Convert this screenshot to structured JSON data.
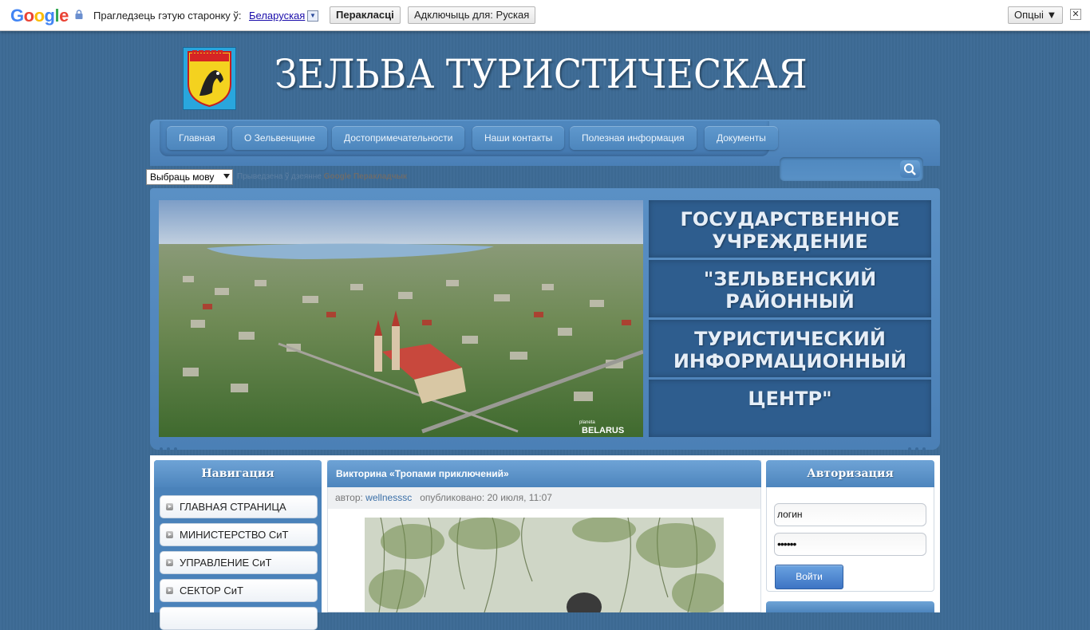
{
  "translate_bar": {
    "prompt": "Прагледзець гэтую старонку ў:",
    "language": "Беларуская",
    "translate_button": "Перакласці",
    "disable_button": "Адключыць для: Руская",
    "options_button": "Опцыі ▼",
    "close": "✕"
  },
  "header": {
    "title": "ЗЕЛЬВА ТУРИСТИЧЕСКАЯ"
  },
  "nav": {
    "items": [
      "Главная",
      "О Зельвенщине",
      "Достопримечательности",
      "Наши контакты",
      "Полезная информация",
      "Документы"
    ]
  },
  "language_select": {
    "value": "Выбраць мову",
    "powered_prefix": "Прыведзена ў дзеянне",
    "powered_brand": "Google",
    "powered_suffix": "Перакладчык"
  },
  "banner": {
    "lines": [
      "ГОСУДАРСТВЕННОЕ УЧРЕЖДЕНИЕ",
      "\"ЗЕЛЬВЕНСКИЙ РАЙОННЫЙ",
      "ТУРИСТИЧЕСКИЙ ИНФОРМАЦИОННЫЙ",
      "ЦЕНТР\""
    ],
    "photo_watermark_small": "planeta",
    "photo_watermark": "BELARUS"
  },
  "sidebar": {
    "title": "Навигация",
    "items": [
      "ГЛАВНАЯ СТРАНИЦА",
      "МИНИСТЕРСТВО СиТ",
      "УПРАВЛЕНИЕ СиТ",
      "СЕКТОР СиТ"
    ]
  },
  "article": {
    "title": "Викторина «Тропами приключений»",
    "author_label": "автор:",
    "author": "wellnesssc",
    "published": "опубликовано: 20 июля, 11:07"
  },
  "auth": {
    "title": "Авторизация",
    "login_value": "логин",
    "password_value": "••••••",
    "submit": "Войти"
  }
}
